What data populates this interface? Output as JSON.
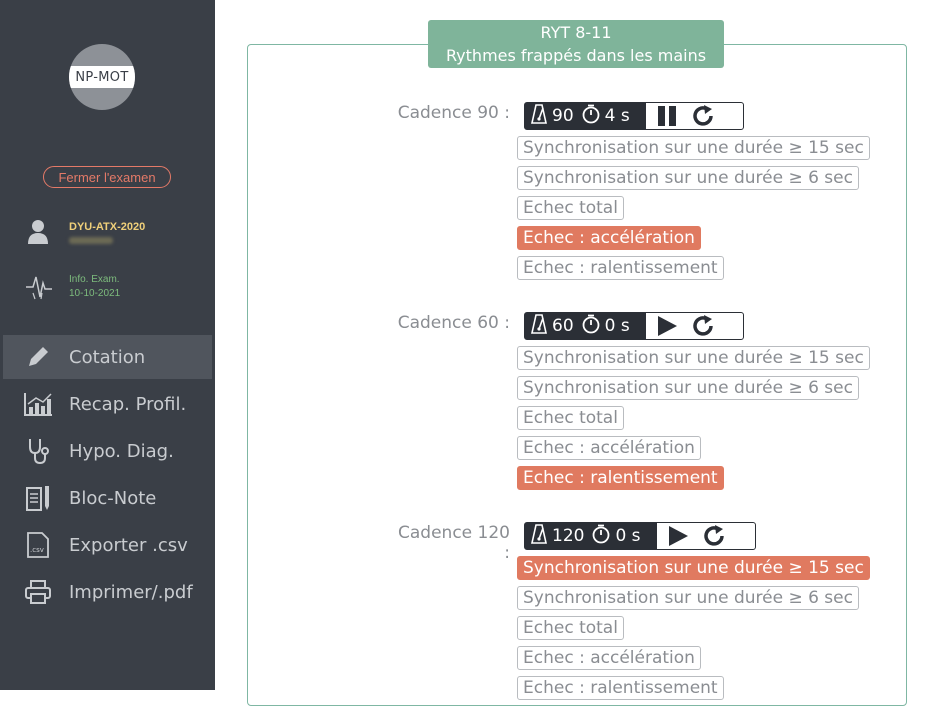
{
  "sidebar": {
    "logo_text": "NP-MOT",
    "close_button": "Fermer l'examen",
    "user_id": "DYU-ATX-2020",
    "exam_label": "Info. Exam.",
    "exam_date": "10-10-2021",
    "nav": [
      {
        "label": "Cotation",
        "icon": "pencil-icon",
        "active": true
      },
      {
        "label": "Recap. Profil.",
        "icon": "chart-icon",
        "active": false
      },
      {
        "label": "Hypo. Diag.",
        "icon": "stethoscope-icon",
        "active": false
      },
      {
        "label": "Bloc-Note",
        "icon": "notepad-icon",
        "active": false
      },
      {
        "label": "Exporter .csv",
        "icon": "csv-file-icon",
        "active": false
      },
      {
        "label": "Imprimer/.pdf",
        "icon": "printer-icon",
        "active": false
      }
    ]
  },
  "exam": {
    "code": "RYT 8-11",
    "title": "Rythmes frappés dans les mains"
  },
  "cadences": [
    {
      "label": "Cadence 90 :",
      "bpm": "90",
      "time": "4 s",
      "state": "playing",
      "options": [
        "Synchronisation sur une durée ≥ 15 sec",
        "Synchronisation sur une durée ≥ 6 sec",
        "Echec total",
        "Echec : accélération",
        "Echec : ralentissement"
      ],
      "selected": 3
    },
    {
      "label": "Cadence 60 :",
      "bpm": "60",
      "time": "0 s",
      "state": "stopped",
      "options": [
        "Synchronisation sur une durée ≥ 15 sec",
        "Synchronisation sur une durée ≥ 6 sec",
        "Echec total",
        "Echec : accélération",
        "Echec : ralentissement"
      ],
      "selected": 4
    },
    {
      "label": "Cadence 120 :",
      "bpm": "120",
      "time": "0 s",
      "state": "stopped",
      "options": [
        "Synchronisation sur une durée ≥ 15 sec",
        "Synchronisation sur une durée ≥ 6 sec",
        "Echec total",
        "Echec : accélération",
        "Echec : ralentissement"
      ],
      "selected": 0
    }
  ],
  "colors": {
    "sidebar_bg": "#3a3f47",
    "accent_green": "#7fb49a",
    "selected_option": "#e07a60",
    "close_button": "#e47a68"
  }
}
